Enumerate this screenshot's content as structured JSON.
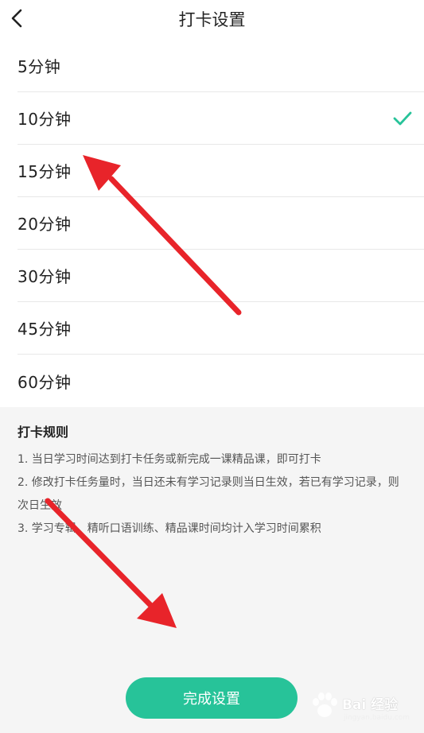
{
  "header": {
    "title": "打卡设置"
  },
  "options": [
    {
      "label": "5分钟",
      "selected": false
    },
    {
      "label": "10分钟",
      "selected": true
    },
    {
      "label": "15分钟",
      "selected": false
    },
    {
      "label": "20分钟",
      "selected": false
    },
    {
      "label": "30分钟",
      "selected": false
    },
    {
      "label": "45分钟",
      "selected": false
    },
    {
      "label": "60分钟",
      "selected": false
    }
  ],
  "rules": {
    "title": "打卡规则",
    "items": [
      "1. 当日学习时间达到打卡任务或新完成一课精品课，即可打卡",
      "2. 修改打卡任务量时，当日还未有学习记录则当日生效，若已有学习记录，则次日生效",
      "3. 学习专辑、精听口语训练、精品课时间均计入学习时间累积"
    ]
  },
  "actions": {
    "done_label": "完成设置"
  },
  "watermark": {
    "text": "Bai 经验",
    "sub": "jingyan.baidu.com"
  },
  "colors": {
    "accent": "#27c399",
    "arrow": "#e8242a"
  }
}
